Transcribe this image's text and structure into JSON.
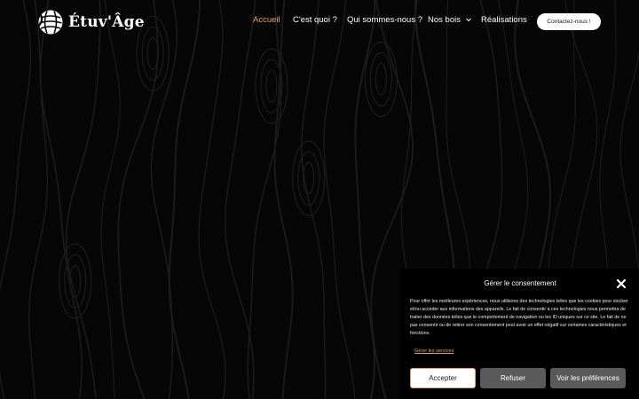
{
  "brand": {
    "name": "Étuv'Âge",
    "logo_icon": "wood-globe-icon"
  },
  "nav": {
    "items": [
      {
        "label": "Accueil",
        "active": true
      },
      {
        "label": "C'est quoi ?"
      },
      {
        "label": "Qui sommes-nous ?"
      },
      {
        "label": "Nos bois",
        "has_dropdown": true
      },
      {
        "label": "Réalisations"
      }
    ],
    "cta_label": "Contactez-nous !"
  },
  "consent": {
    "title": "Gérer le consentement",
    "close_icon": "close-icon",
    "body": "Pour offrir les meilleures expériences, nous utilisons des technologies telles que les cookies pour stocker et/ou accéder aux informations des appareils. Le fait de consentir à ces technologies nous permettra de traiter des données telles que le comportement de navigation ou les ID uniques sur ce site. Le fait de ne pas consentir ou de retirer son consentement peut avoir un effet négatif sur certaines caractéristiques et fonctions.",
    "manage_link": "Gérer les services",
    "buttons": {
      "accept": "Accepter",
      "refuse": "Refuser",
      "preferences": "Voir les préférences"
    }
  },
  "colors": {
    "background": "#060606",
    "accent": "#e3a26a",
    "grain": "#1c1c1c",
    "secondary_button": "#5a5a5a"
  }
}
